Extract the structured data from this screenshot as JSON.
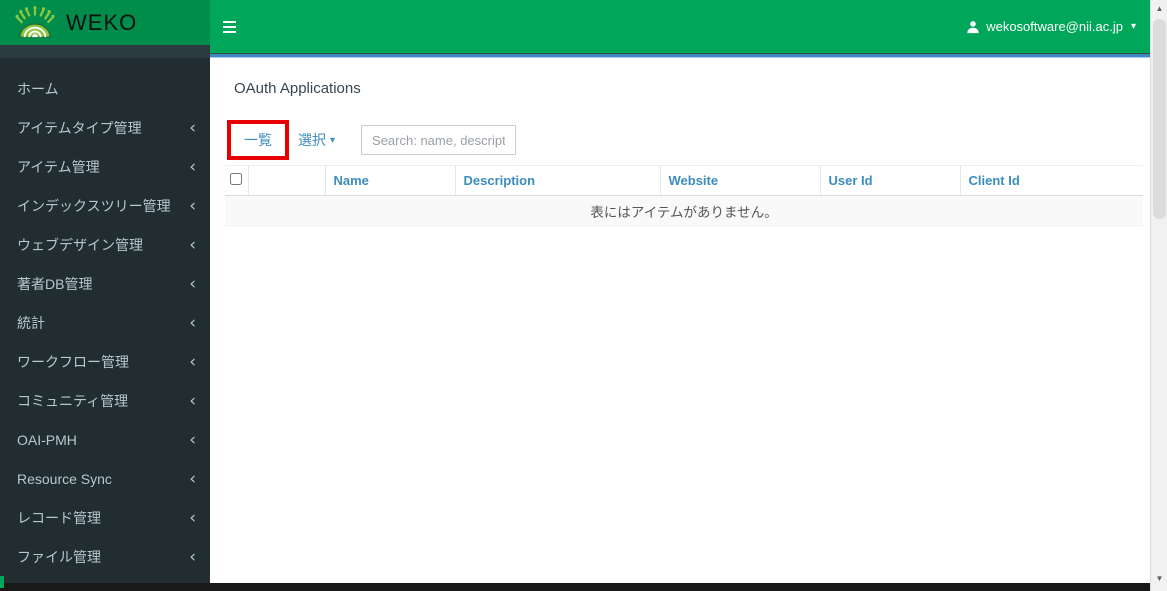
{
  "header": {
    "brand": "WEKO",
    "user_email": "wekosoftware@nii.ac.jp"
  },
  "icons": {
    "chevron_left": "‹",
    "caret_down": "▾",
    "scroll_up": "▲",
    "scroll_down": "▼"
  },
  "sidebar": {
    "items": [
      {
        "label": "ホーム",
        "has_submenu": false
      },
      {
        "label": "アイテムタイプ管理",
        "has_submenu": true
      },
      {
        "label": "アイテム管理",
        "has_submenu": true
      },
      {
        "label": "インデックスツリー管理",
        "has_submenu": true
      },
      {
        "label": "ウェブデザイン管理",
        "has_submenu": true
      },
      {
        "label": "著者DB管理",
        "has_submenu": true
      },
      {
        "label": "統計",
        "has_submenu": true
      },
      {
        "label": "ワークフロー管理",
        "has_submenu": true
      },
      {
        "label": "コミュニティ管理",
        "has_submenu": true
      },
      {
        "label": "OAI-PMH",
        "has_submenu": true
      },
      {
        "label": "Resource Sync",
        "has_submenu": true
      },
      {
        "label": "レコード管理",
        "has_submenu": true
      },
      {
        "label": "ファイル管理",
        "has_submenu": true
      }
    ]
  },
  "main": {
    "title": "OAuth Applications",
    "toolbar": {
      "list_label": "一覧",
      "select_label": "選択",
      "search_placeholder": "Search: name, description"
    },
    "table": {
      "columns": [
        "Name",
        "Description",
        "Website",
        "User Id",
        "Client Id"
      ],
      "empty_message": "表にはアイテムがありません。"
    }
  },
  "colors": {
    "navbar_green": "#00a65a",
    "logo_green": "#008d4c",
    "sidebar_dark": "#222d32",
    "link_blue": "#3c8dbc",
    "annotation_red": "#e80000",
    "logo_icon_green": "#8dc63f"
  }
}
